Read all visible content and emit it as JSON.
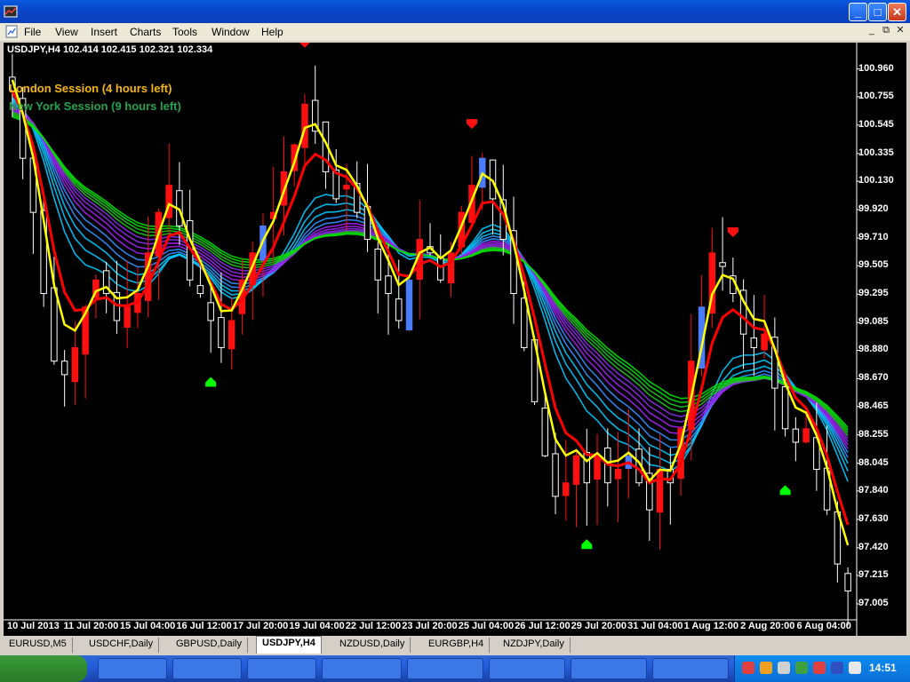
{
  "window": {
    "title": "",
    "minimize_glyph": "_",
    "maximize_glyph": "□",
    "close_glyph": "✕"
  },
  "menu": {
    "items": [
      "File",
      "View",
      "Insert",
      "Charts",
      "Tools",
      "Window",
      "Help"
    ],
    "restore_glyph": "⧉",
    "close_glyph": "✕"
  },
  "chart": {
    "symbol_line": "USDJPY,H4  102.414 102.415 102.321 102.334",
    "sessions": {
      "london": "London Session (4 hours left)",
      "new_york": "New York Session (9 hours left)"
    },
    "colors": {
      "background": "#000000",
      "bull": "#ff1010",
      "bear": "#ffffff",
      "bull_alt": "#4a7cff",
      "ema_fast": "#ffff00",
      "ema_mid": "#ff0000",
      "ribbon": [
        "#00c8ff",
        "#3090ff",
        "#a020f0",
        "#8a2be2",
        "#20c020",
        "#00e000"
      ],
      "arrow_up": "#00ff00",
      "arrow_down": "#ff1010"
    },
    "icons": {
      "up_arrow": "arrow-up-signal-icon",
      "down_arrow": "arrow-down-signal-icon"
    }
  },
  "chart_data": {
    "type": "candlestick",
    "title": "USDJPY,H4",
    "ylim": [
      96.9,
      101.05
    ],
    "y_ticks": [
      "100.960",
      "100.755",
      "100.545",
      "100.335",
      "100.130",
      "99.920",
      "99.710",
      "99.505",
      "99.295",
      "99.085",
      "98.880",
      "98.670",
      "98.465",
      "98.255",
      "98.045",
      "97.840",
      "97.630",
      "97.420",
      "97.215",
      "97.005"
    ],
    "x_ticks": [
      "10 Jul 2013",
      "11 Jul 20:00",
      "15 Jul 04:00",
      "16 Jul 12:00",
      "17 Jul 20:00",
      "19 Jul 04:00",
      "22 Jul 12:00",
      "23 Jul 20:00",
      "25 Jul 04:00",
      "26 Jul 12:00",
      "29 Jul 20:00",
      "31 Jul 04:00",
      "1 Aug 12:00",
      "2 Aug 20:00",
      "6 Aug 04:00"
    ],
    "series": [
      {
        "name": "USDJPY H4 close",
        "values": [
          100.8,
          100.3,
          99.9,
          99.3,
          98.8,
          98.7,
          98.9,
          99.2,
          99.4,
          99.3,
          99.1,
          99.2,
          99.3,
          99.6,
          99.9,
          100.1,
          99.8,
          99.4,
          99.3,
          99.1,
          98.9,
          99.1,
          99.4,
          99.6,
          99.8,
          99.9,
          100.2,
          100.4,
          100.7,
          100.5,
          100.2,
          100.0,
          100.1,
          99.9,
          99.7,
          99.4,
          99.3,
          99.1,
          99.4,
          99.7,
          99.6,
          99.4,
          99.6,
          99.9,
          100.1,
          100.3,
          100.0,
          99.7,
          99.3,
          98.9,
          98.5,
          98.1,
          97.8,
          97.9,
          98.1,
          97.9,
          98.1,
          97.9,
          98.0,
          98.1,
          97.9,
          97.7,
          98.0,
          97.9,
          98.3,
          98.8,
          99.2,
          99.6,
          99.5,
          99.3,
          99.0,
          98.9,
          99.0,
          98.6,
          98.3,
          98.2,
          98.3,
          98.0,
          97.7,
          97.3,
          97.1
        ]
      }
    ],
    "signals": [
      {
        "type": "down",
        "index": 28
      },
      {
        "type": "up",
        "index": 19
      },
      {
        "type": "down",
        "index": 44
      },
      {
        "type": "up",
        "index": 55
      },
      {
        "type": "down",
        "index": 69
      },
      {
        "type": "up",
        "index": 74
      }
    ],
    "grid": false
  },
  "tabs": {
    "items": [
      "EURUSD,M5",
      "USDCHF,Daily",
      "GBPUSD,Daily",
      "USDJPY,H4",
      "NZDUSD,Daily",
      "EURGBP,H4",
      "NZDJPY,Daily"
    ],
    "active": "USDJPY,H4"
  },
  "taskbar": {
    "clock": "14:51"
  }
}
